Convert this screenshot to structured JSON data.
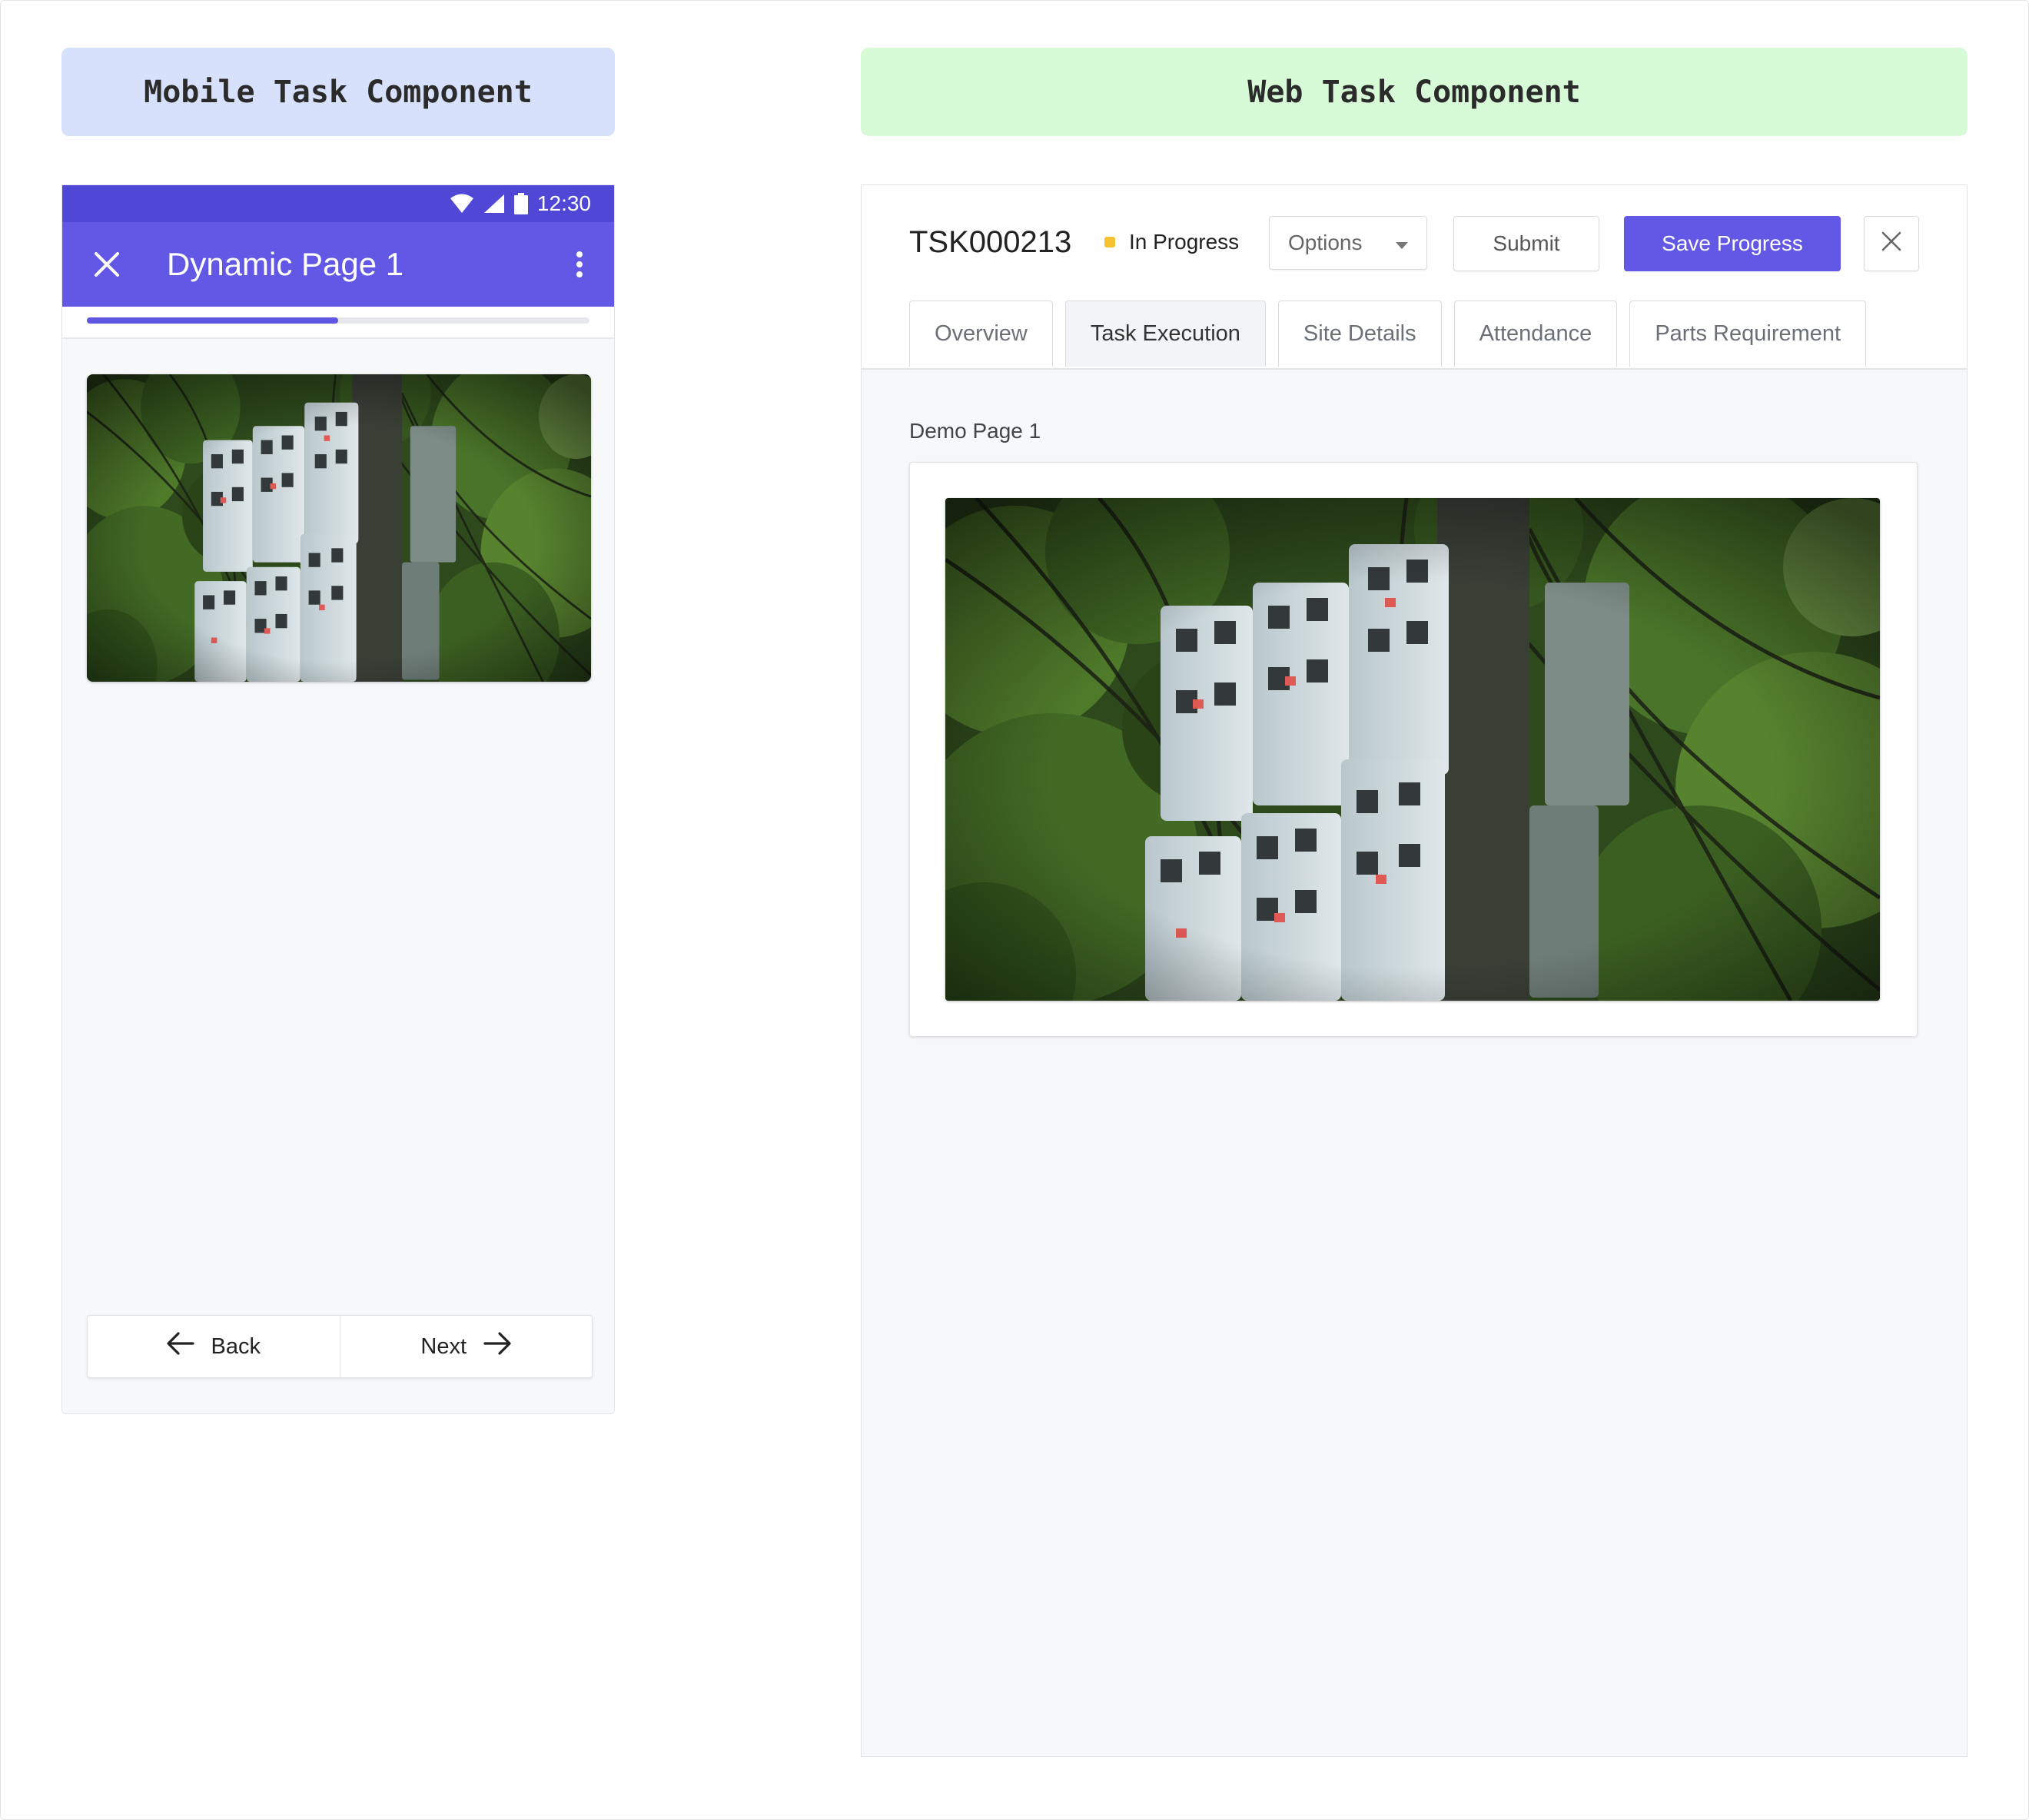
{
  "labels": {
    "mobile": "Mobile Task Component",
    "web": "Web Task Component"
  },
  "mobile": {
    "status_bar": {
      "time": "12:30",
      "icons": [
        "wifi-icon",
        "signal-icon",
        "battery-icon"
      ]
    },
    "app_bar": {
      "title": "Dynamic Page 1",
      "close_icon": "close-icon",
      "menu_icon": "more-vert-icon"
    },
    "progress": 0.5,
    "image": {
      "subject": "electricity meters on a pole among trees"
    },
    "nav": {
      "back_label": "Back",
      "next_label": "Next"
    }
  },
  "web": {
    "task_id": "TSK000213",
    "status": {
      "label": "In Progress",
      "color": "#f6c231"
    },
    "options": {
      "label": "Options"
    },
    "buttons": {
      "submit": "Submit",
      "save": "Save Progress"
    },
    "tabs": [
      {
        "label": "Overview",
        "active": false
      },
      {
        "label": "Task Execution",
        "active": true
      },
      {
        "label": "Site Details",
        "active": false
      },
      {
        "label": "Attendance",
        "active": false
      },
      {
        "label": "Parts Requirement",
        "active": false
      }
    ],
    "page_label": "Demo Page 1",
    "image": {
      "subject": "electricity meters on a pole among trees"
    }
  },
  "colors": {
    "primary": "#6357e6",
    "primary_dark": "#5147d6",
    "mobile_label_bg": "#d8e1fb",
    "web_label_bg": "#d7fbd6",
    "status_yellow": "#f6c231"
  }
}
